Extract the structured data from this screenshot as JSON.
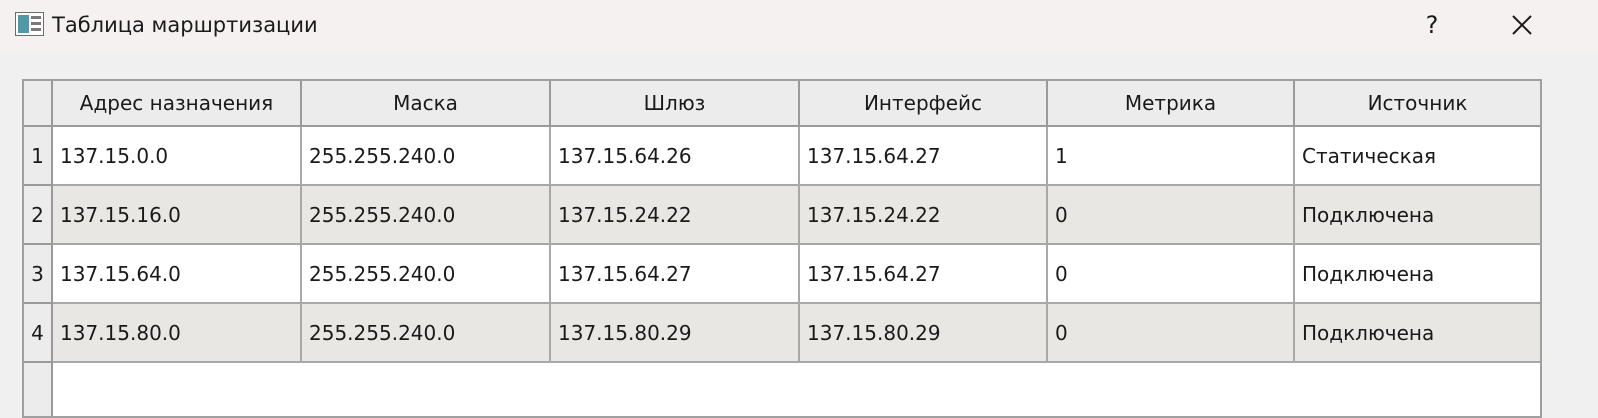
{
  "window": {
    "title": "Таблица маршртизации",
    "help_label": "?",
    "close_label": "✕",
    "icon": "table-app-icon"
  },
  "table": {
    "columns": [
      "Адрес назначения",
      "Маска",
      "Шлюз",
      "Интерфейс",
      "Метрика",
      "Источник"
    ],
    "rows": [
      {
        "num": "1",
        "cells": [
          "137.15.0.0",
          "255.255.240.0",
          "137.15.64.26",
          "137.15.64.27",
          "1",
          "Статическая"
        ]
      },
      {
        "num": "2",
        "cells": [
          "137.15.16.0",
          "255.255.240.0",
          "137.15.24.22",
          "137.15.24.22",
          "0",
          "Подключена"
        ]
      },
      {
        "num": "3",
        "cells": [
          "137.15.64.0",
          "255.255.240.0",
          "137.15.64.27",
          "137.15.64.27",
          "0",
          "Подключена"
        ]
      },
      {
        "num": "4",
        "cells": [
          "137.15.80.0",
          "255.255.240.0",
          "137.15.80.29",
          "137.15.80.29",
          "0",
          "Подключена"
        ]
      }
    ]
  },
  "colors": {
    "header_bg": "#ececec",
    "alt_row_bg": "#e8e7e4",
    "grid_line": "#a8a8a8"
  }
}
